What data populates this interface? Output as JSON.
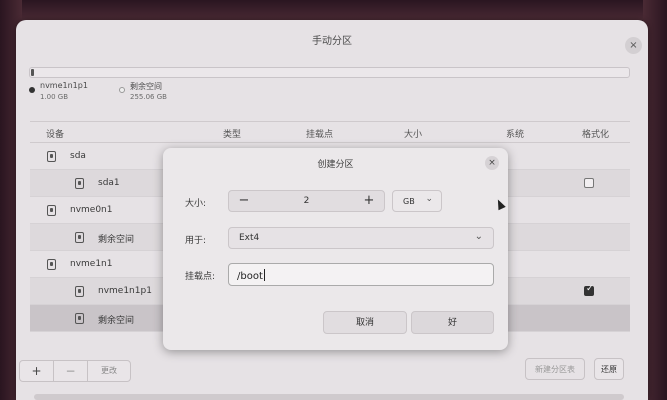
{
  "window": {
    "title": "手动分区",
    "close_glyph": "×"
  },
  "partition_bar": {
    "used_fraction": 0.004
  },
  "legend": [
    {
      "name": "nvme1n1p1",
      "size": "1.00 GB"
    },
    {
      "name": "剩余空间",
      "size": "255.06 GB"
    }
  ],
  "table": {
    "headers": {
      "device": "设备",
      "type": "类型",
      "mount": "挂载点",
      "size": "大小",
      "system": "系统",
      "format": "格式化"
    },
    "rows": [
      {
        "label": "sda",
        "level": 0,
        "checkbox": "none"
      },
      {
        "label": "sda1",
        "level": 1,
        "checkbox": "off"
      },
      {
        "label": "nvme0n1",
        "level": 0,
        "checkbox": "none"
      },
      {
        "label": "剩余空间",
        "level": 1,
        "checkbox": "none"
      },
      {
        "label": "nvme1n1",
        "level": 0,
        "checkbox": "none"
      },
      {
        "label": "nvme1n1p1",
        "level": 1,
        "checkbox": "on"
      },
      {
        "label": "剩余空间",
        "level": 1,
        "checkbox": "none",
        "selected": true
      }
    ]
  },
  "toolbar": {
    "add": "+",
    "remove": "−",
    "change": "更改",
    "new_table": "新建分区表",
    "revert": "还原"
  },
  "dialog": {
    "title": "创建分区",
    "close_glyph": "×",
    "size_label": "大小:",
    "size_value": "2",
    "minus": "−",
    "plus": "+",
    "unit": "GB",
    "use_label": "用于:",
    "use_value": "Ext4",
    "mount_label": "挂载点:",
    "mount_value": "/boot",
    "cancel": "取消",
    "ok": "好"
  },
  "icons": {
    "chevron": "chevron-down-icon",
    "disk": "disk-icon",
    "partition": "partition-icon"
  }
}
